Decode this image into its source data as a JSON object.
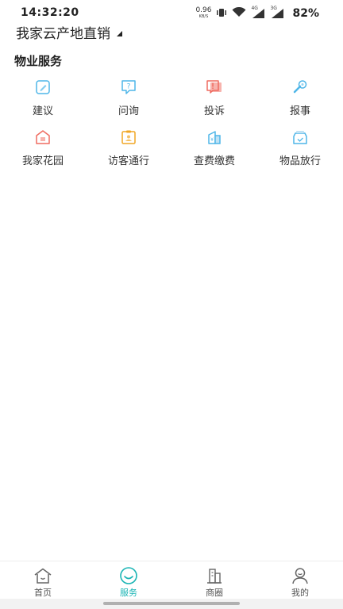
{
  "status_bar": {
    "time": "14:32:20",
    "net_speed_value": "0.96",
    "net_speed_unit": "KB/S",
    "net_4g": "4G",
    "net_3g": "3G",
    "battery": "82%"
  },
  "header": {
    "location_title": "我家云产地直销"
  },
  "section": {
    "title": "物业服务"
  },
  "services": [
    {
      "label": "建议",
      "icon": "suggestion-icon",
      "color": "#4fb6e8"
    },
    {
      "label": "问询",
      "icon": "inquiry-icon",
      "color": "#4fb6e8"
    },
    {
      "label": "投诉",
      "icon": "complaint-icon",
      "color": "#ef6b60"
    },
    {
      "label": "报事",
      "icon": "wrench-icon",
      "color": "#4fb6e8"
    },
    {
      "label": "我家花园",
      "icon": "garden-icon",
      "color": "#ef6b60"
    },
    {
      "label": "访客通行",
      "icon": "visitor-pass-icon",
      "color": "#f0a623"
    },
    {
      "label": "查费缴费",
      "icon": "fee-payment-icon",
      "color": "#4fb6e8"
    },
    {
      "label": "物品放行",
      "icon": "item-release-icon",
      "color": "#4fb6e8"
    }
  ],
  "bottom_nav": {
    "active": "服务",
    "items": [
      {
        "label": "首页",
        "icon": "home-icon"
      },
      {
        "label": "服务",
        "icon": "service-smile-icon"
      },
      {
        "label": "商圈",
        "icon": "business-district-icon"
      },
      {
        "label": "我的",
        "icon": "profile-icon"
      }
    ]
  },
  "colors": {
    "accent": "#19b4b4",
    "blue_icon": "#4fb6e8",
    "red_icon": "#ef6b60",
    "orange_icon": "#f0a623"
  }
}
